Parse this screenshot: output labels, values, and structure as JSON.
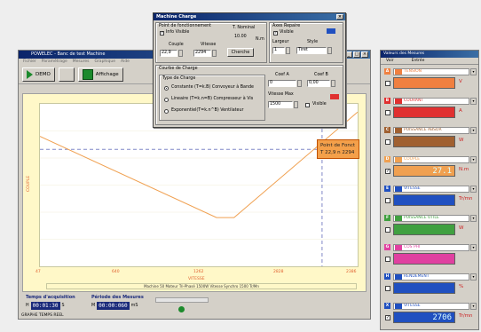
{
  "main_window": {
    "title": "POWELEC - Banc de test Machine",
    "menu": [
      "Fichier",
      "Paramétrage",
      "Mesures",
      "Graphique",
      "Aide"
    ],
    "toolbar": {
      "demo_label": "DEMO",
      "affichage_label": "Affichage"
    },
    "chart": {
      "ylabel": "COUPLE",
      "xlabel": "VITESSE",
      "x_ticks": [
        "47",
        "640",
        "1262",
        "2828",
        "2386"
      ],
      "info": "Machine 50   Moteur   Tri-Phasé   1500W   Vitesse Synchro 1500 Tr/Mn"
    },
    "point_box": {
      "title": "Point de Fonct",
      "value": "T 22,9 n 2294"
    },
    "acq": {
      "label": "Temps d'acquisition",
      "h": "H",
      "value": "00:01:30",
      "unit": "S"
    },
    "period": {
      "label": "Période des Mesures",
      "m": "M",
      "value": "00:00:060",
      "unit": "mS"
    },
    "status": "GRAPHE TEMPS REEL"
  },
  "chart_data": {
    "type": "line",
    "xlabel": "VITESSE",
    "ylabel": "COUPLE",
    "x_ticks": [
      "47",
      "640",
      "1262",
      "2828",
      "2386"
    ],
    "series": [
      {
        "x": [
          0.0,
          0.556,
          0.611,
          1.0
        ],
        "y": [
          0.8,
          0.3,
          0.3,
          0.95
        ]
      }
    ],
    "operating_point": {
      "label": "T 22,9 n 2294"
    }
  },
  "dialog": {
    "title": "Machine Charge",
    "pf_group": "Point de fonctionnement",
    "info_visible": "Info Visible",
    "t_nominal": "T. Nominal",
    "t_nominal_value": "10.00",
    "t_unit": "N.m",
    "couple_label": "Couple",
    "vitesse_label": "Vitesse",
    "couple_value": "22,9",
    "vitesse_value": "2294",
    "cherche_label": "Cherche",
    "repere_group": "Axes Repaire",
    "repere_visible": "Visible",
    "largeur_label": "Largeur",
    "style_label": "Style",
    "largeur_value": "1",
    "style_value": "Tiret",
    "courbe_group": "Courbe de Charge",
    "type_group": "Type de Charge",
    "types": [
      "Constante  (T=k.B) Convoyeur à Bande",
      "Lineaire   (T=k.n=B) Compresseur à Vis",
      "Exponentiel(T=k.n^B) Ventilateur"
    ],
    "coef_a_label": "Coef A",
    "coef_b_label": "Coef B",
    "coef_a_value": "0",
    "coef_b_value": "0,00",
    "vitesse_max_label": "Vitesse Max",
    "vitesse_max_value": "1500",
    "courbe_visible": "Visible",
    "color_blue": "#2050c0",
    "color_red": "#e03030"
  },
  "right_panel": {
    "title": "Valeurs des Mesures",
    "col_voir": "Voir",
    "col_entree": "Entrée",
    "measures": [
      {
        "num": "A",
        "name": "TENSION",
        "value": "",
        "unit": "V",
        "checked": false,
        "color": "#f08040"
      },
      {
        "num": "B",
        "name": "COURANT",
        "value": "",
        "unit": "A",
        "checked": false,
        "color": "#e03030"
      },
      {
        "num": "C",
        "name": "PUISSANCE ABSOR",
        "value": "",
        "unit": "W",
        "checked": false,
        "color": "#a06030"
      },
      {
        "num": "D",
        "name": "COUPLE",
        "value": "27.1",
        "unit": "N.m",
        "checked": true,
        "color": "#f0a050"
      },
      {
        "num": "E",
        "name": "VITESSE",
        "value": "",
        "unit": "Tr/mn",
        "checked": false,
        "color": "#2050c0"
      },
      {
        "num": "F",
        "name": "PUISSANCE UTILE",
        "value": "",
        "unit": "W",
        "checked": false,
        "color": "#40a040"
      },
      {
        "num": "G",
        "name": "COS PHI",
        "value": "",
        "unit": "",
        "checked": false,
        "color": "#e040a0"
      },
      {
        "num": "H",
        "name": "RENDEMENT",
        "value": "",
        "unit": "%",
        "checked": false,
        "color": "#2050c0"
      },
      {
        "num": "X",
        "name": "VITESSE",
        "value": "2706",
        "unit": "Tr/mn",
        "checked": true,
        "color": "#2050c0"
      }
    ]
  }
}
